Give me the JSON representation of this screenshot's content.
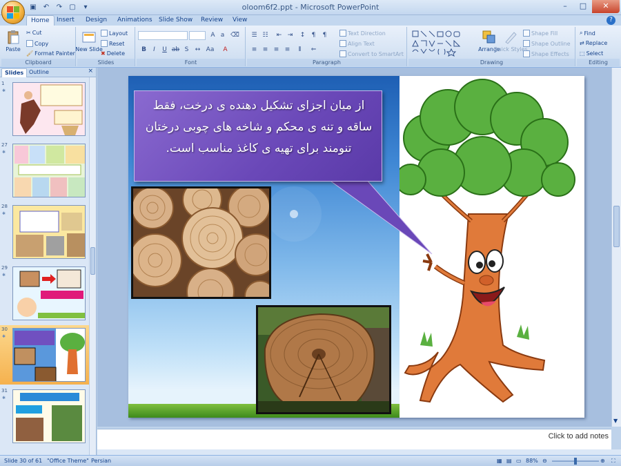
{
  "window": {
    "title": "oloom6f2.ppt - Microsoft PowerPoint"
  },
  "tabs": [
    {
      "label": "Home",
      "active": true
    },
    {
      "label": "Insert"
    },
    {
      "label": "Design"
    },
    {
      "label": "Animations"
    },
    {
      "label": "Slide Show"
    },
    {
      "label": "Review"
    },
    {
      "label": "View"
    }
  ],
  "ribbon": {
    "clipboard": {
      "label": "Clipboard",
      "paste": "Paste",
      "cut": "Cut",
      "copy": "Copy",
      "format_painter": "Format Painter"
    },
    "slides": {
      "label": "Slides",
      "new_slide": "New Slide",
      "layout": "Layout",
      "reset": "Reset",
      "delete": "Delete"
    },
    "font": {
      "label": "Font"
    },
    "paragraph": {
      "label": "Paragraph",
      "text_direction": "Text Direction",
      "align_text": "Align Text",
      "convert_smartart": "Convert to SmartArt"
    },
    "drawing": {
      "label": "Drawing",
      "arrange": "Arrange",
      "quick_styles": "Quick Styles",
      "shape_fill": "Shape Fill",
      "shape_outline": "Shape Outline",
      "shape_effects": "Shape Effects"
    },
    "editing": {
      "label": "Editing",
      "find": "Find",
      "replace": "Replace",
      "select": "Select"
    }
  },
  "panel": {
    "tab_slides": "Slides",
    "tab_outline": "Outline",
    "close": "×",
    "thumbnails": [
      {
        "num": "1"
      },
      {
        "num": "27"
      },
      {
        "num": "28"
      },
      {
        "num": "29"
      },
      {
        "num": "30",
        "selected": true
      },
      {
        "num": "31"
      }
    ]
  },
  "slide": {
    "callout_text": "از میان اجزای تشکیل دهنده ی درخت، فقط ساقه و تنه ی محکم و شاخه های چوبی درختان تنومند برای تهیه ی کاغذ مناسب است."
  },
  "notes": {
    "placeholder": "Click to add notes"
  },
  "status": {
    "slide_info": "Slide 30 of 61",
    "theme": "\"Office Theme\"",
    "language": "Persian",
    "zoom": "88%"
  },
  "colors": {
    "ribbon_bg": "#d7e4f4",
    "callout": "#6a48b8",
    "selected_thumb": "#f5b14e"
  }
}
